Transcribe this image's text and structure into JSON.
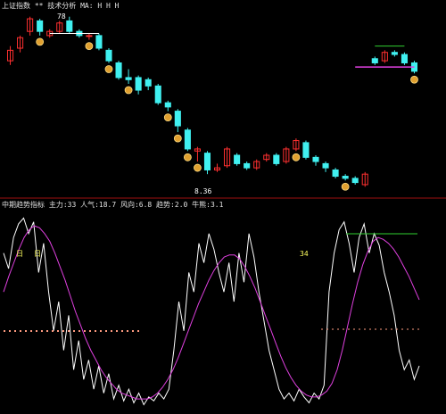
{
  "top_panel": {
    "header": "上证指数 ** 技术分析 MA:  H  H  H",
    "price_labels": {
      "upper": "78",
      "lower": "8.36"
    }
  },
  "bottom_panel": {
    "header": "中期趋势指标  主力:33  人气:18.7  风向:6.8  趋势:2.0  牛熊:3.1",
    "markers": {
      "tl": "日",
      "tm": "日",
      "tr": "34"
    }
  },
  "colors": {
    "background": "#000000",
    "up": "#ff3030",
    "down": "#40f0f0",
    "divider": "#a01010",
    "line_white": "#ffffff",
    "line_magenta": "#e040e0",
    "line_green": "#30d030",
    "dot_salmon": "#ff9b80",
    "coin": "#e0a030"
  },
  "chart_data": [
    {
      "type": "candlestick",
      "title": "",
      "candles": [
        {
          "x": 1,
          "o": 7.0,
          "c": 7.25,
          "h": 7.35,
          "l": 6.9
        },
        {
          "x": 2,
          "o": 7.3,
          "c": 7.55,
          "h": 7.6,
          "l": 7.2
        },
        {
          "x": 3,
          "o": 7.7,
          "c": 8.0,
          "h": 8.05,
          "l": 7.6
        },
        {
          "x": 4,
          "o": 7.95,
          "c": 7.7,
          "h": 8.0,
          "l": 7.6
        },
        {
          "x": 5,
          "o": 7.6,
          "c": 7.7,
          "h": 7.75,
          "l": 7.55
        },
        {
          "x": 6,
          "o": 7.7,
          "c": 7.9,
          "h": 7.95,
          "l": 7.65
        },
        {
          "x": 7,
          "o": 7.95,
          "c": 7.7,
          "h": 8.05,
          "l": 7.65
        },
        {
          "x": 8,
          "o": 7.7,
          "c": 7.6,
          "h": 7.75,
          "l": 7.55
        },
        {
          "x": 9,
          "o": 7.6,
          "c": 7.6,
          "h": 7.65,
          "l": 7.5
        },
        {
          "x": 10,
          "o": 7.6,
          "c": 7.3,
          "h": 7.65,
          "l": 7.25
        },
        {
          "x": 11,
          "o": 7.25,
          "c": 7.0,
          "h": 7.3,
          "l": 6.95
        },
        {
          "x": 12,
          "o": 6.95,
          "c": 6.6,
          "h": 7.0,
          "l": 6.55
        },
        {
          "x": 13,
          "o": 6.6,
          "c": 6.55,
          "h": 6.8,
          "l": 6.45
        },
        {
          "x": 14,
          "o": 6.6,
          "c": 6.3,
          "h": 6.65,
          "l": 6.2
        },
        {
          "x": 15,
          "o": 6.55,
          "c": 6.4,
          "h": 6.6,
          "l": 6.3
        },
        {
          "x": 16,
          "o": 6.4,
          "c": 6.0,
          "h": 6.45,
          "l": 5.95
        },
        {
          "x": 17,
          "o": 6.0,
          "c": 5.9,
          "h": 6.05,
          "l": 5.8
        },
        {
          "x": 18,
          "o": 5.8,
          "c": 5.45,
          "h": 5.85,
          "l": 5.3
        },
        {
          "x": 19,
          "o": 5.35,
          "c": 4.9,
          "h": 5.4,
          "l": 4.85
        },
        {
          "x": 20,
          "o": 4.85,
          "c": 4.9,
          "h": 4.95,
          "l": 4.6
        },
        {
          "x": 21,
          "o": 4.8,
          "c": 4.4,
          "h": 4.85,
          "l": 4.3
        },
        {
          "x": 22,
          "o": 4.4,
          "c": 4.45,
          "h": 4.55,
          "l": 4.35
        },
        {
          "x": 23,
          "o": 4.5,
          "c": 4.9,
          "h": 4.95,
          "l": 4.45
        },
        {
          "x": 24,
          "o": 4.75,
          "c": 4.55,
          "h": 4.8,
          "l": 4.5
        },
        {
          "x": 25,
          "o": 4.55,
          "c": 4.45,
          "h": 4.6,
          "l": 4.4
        },
        {
          "x": 26,
          "o": 4.45,
          "c": 4.6,
          "h": 4.65,
          "l": 4.4
        },
        {
          "x": 27,
          "o": 4.65,
          "c": 4.75,
          "h": 4.8,
          "l": 4.6
        },
        {
          "x": 28,
          "o": 4.75,
          "c": 4.55,
          "h": 4.8,
          "l": 4.5
        },
        {
          "x": 29,
          "o": 4.6,
          "c": 4.9,
          "h": 4.95,
          "l": 4.55
        },
        {
          "x": 30,
          "o": 4.9,
          "c": 5.1,
          "h": 5.15,
          "l": 4.85
        },
        {
          "x": 31,
          "o": 5.05,
          "c": 4.7,
          "h": 5.1,
          "l": 4.65
        },
        {
          "x": 32,
          "o": 4.7,
          "c": 4.6,
          "h": 4.75,
          "l": 4.5
        },
        {
          "x": 33,
          "o": 4.55,
          "c": 4.45,
          "h": 4.6,
          "l": 4.35
        },
        {
          "x": 34,
          "o": 4.4,
          "c": 4.25,
          "h": 4.45,
          "l": 4.2
        },
        {
          "x": 35,
          "o": 4.25,
          "c": 4.2,
          "h": 4.3,
          "l": 4.15
        },
        {
          "x": 36,
          "o": 4.2,
          "c": 4.1,
          "h": 4.25,
          "l": 4.05
        },
        {
          "x": 37,
          "o": 4.05,
          "c": 4.3,
          "h": 4.35,
          "l": 4.0
        },
        {
          "x": 38,
          "o": 7.05,
          "c": 6.95,
          "h": 7.1,
          "l": 6.9
        },
        {
          "x": 39,
          "o": 7.0,
          "c": 7.2,
          "h": 7.25,
          "l": 6.95
        },
        {
          "x": 40,
          "o": 7.2,
          "c": 7.15,
          "h": 7.25,
          "l": 7.1
        },
        {
          "x": 41,
          "o": 7.15,
          "c": 6.95,
          "h": 7.2,
          "l": 6.9
        },
        {
          "x": 42,
          "o": 6.95,
          "c": 6.75,
          "h": 7.0,
          "l": 6.7
        }
      ],
      "signals": [
        4,
        9,
        11,
        13,
        17,
        18,
        19,
        20,
        30,
        35,
        42
      ]
    },
    {
      "type": "line",
      "title": "",
      "x": [
        1,
        2,
        3,
        4,
        5,
        6,
        7,
        8,
        9,
        10,
        11,
        12,
        13,
        14,
        15,
        16,
        17,
        18,
        19,
        20,
        21,
        22,
        23,
        24,
        25,
        26,
        27,
        28,
        29,
        30,
        31,
        32,
        33,
        34,
        35,
        36,
        37,
        38,
        39,
        40,
        41,
        42,
        43,
        44,
        45,
        46,
        47,
        48,
        49,
        50,
        51,
        52,
        53,
        54,
        55,
        56,
        57,
        58,
        59,
        60,
        61,
        62,
        63,
        64,
        65,
        66,
        67,
        68,
        69,
        70,
        71,
        72,
        73,
        74,
        75,
        76,
        77,
        78,
        79,
        80,
        81,
        82,
        83,
        84,
        85,
        86,
        87,
        88,
        89,
        90,
        91,
        92,
        93,
        94,
        95,
        96,
        97,
        98,
        99,
        100
      ],
      "series": [
        {
          "values": [
            80,
            72,
            88,
            95,
            98,
            90,
            96,
            70,
            85,
            60,
            40,
            55,
            30,
            48,
            20,
            35,
            15,
            25,
            10,
            22,
            8,
            18,
            5,
            12,
            4,
            10,
            3,
            8,
            2,
            6,
            4,
            8,
            5,
            10,
            30,
            55,
            40,
            70,
            60,
            85,
            75,
            90,
            82,
            70,
            60,
            75,
            55,
            80,
            65,
            90,
            78,
            60,
            45,
            30,
            20,
            10,
            5,
            8,
            4,
            10,
            6,
            3,
            8,
            5,
            12,
            60,
            80,
            92,
            96,
            85,
            70,
            88,
            95,
            80,
            90,
            84,
            70,
            60,
            48,
            30,
            20,
            25,
            15,
            22
          ]
        },
        {
          "values": [
            60,
            68,
            75,
            82,
            88,
            92,
            94,
            93,
            90,
            86,
            80,
            73,
            66,
            58,
            50,
            43,
            36,
            30,
            25,
            20,
            16,
            13,
            10,
            8,
            7,
            6,
            5,
            5,
            5,
            6,
            8,
            11,
            15,
            20,
            26,
            33,
            40,
            47,
            54,
            60,
            66,
            71,
            75,
            78,
            79,
            79,
            77,
            73,
            68,
            62,
            55,
            48,
            41,
            34,
            27,
            21,
            16,
            12,
            9,
            7,
            6,
            6,
            7,
            9,
            13,
            20,
            30,
            42,
            54,
            65,
            74,
            81,
            86,
            88,
            87,
            85,
            82,
            78,
            73,
            68,
            62,
            56
          ]
        }
      ]
    }
  ]
}
